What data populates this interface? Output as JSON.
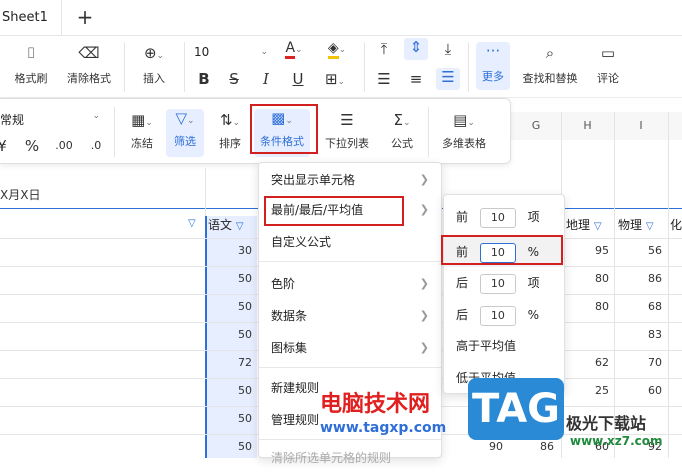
{
  "tabbar": {
    "sheet_name": "Sheet1",
    "add_label": "+"
  },
  "ribbon": {
    "format_painter": "格式刷",
    "clear_format": "清除格式",
    "insert": "插入",
    "font_size": "10",
    "more": "更多",
    "find_replace": "查找和替换",
    "comment": "评论"
  },
  "toolbar2": {
    "number_format": "常规",
    "percent": "%",
    "freeze": "冻结",
    "filter": "筛选",
    "sort": "排序",
    "conditional_format": "条件格式",
    "dropdown_list": "下拉列表",
    "formula": "公式",
    "multi_table": "多维表格"
  },
  "sheet": {
    "date_cell": "X月X日",
    "col_letters": [
      "G",
      "H",
      "I"
    ],
    "headers": {
      "chinese": "语文",
      "geography": "地理",
      "physics": "物理",
      "chem_partial": "化"
    },
    "chinese_values": [
      "30",
      "50",
      "50",
      "50",
      "72",
      "50",
      "50",
      "50"
    ],
    "geography_values": [
      "95",
      "80",
      "80",
      "",
      "62",
      "25",
      "",
      "60"
    ],
    "physics_values": [
      "56",
      "86",
      "68",
      "83",
      "70",
      "60",
      "",
      "92"
    ],
    "bottom_values": [
      "90",
      "86"
    ]
  },
  "menu": {
    "items": [
      "突出显示单元格",
      "最前/最后/平均值",
      "自定义公式",
      "色阶",
      "数据条",
      "图标集",
      "新建规则",
      "管理规则",
      "清除所选单元格的规则"
    ]
  },
  "submenu": {
    "top_n": {
      "prefix": "前",
      "value": "10",
      "suffix": "项"
    },
    "top_pct": {
      "prefix": "前",
      "value": "10",
      "suffix": "%"
    },
    "bottom_n": {
      "prefix": "后",
      "value": "10",
      "suffix": "项"
    },
    "bottom_pct": {
      "prefix": "后",
      "value": "10",
      "suffix": "%"
    },
    "above_avg": "高于平均值",
    "below_avg": "低于平均值"
  },
  "watermark": {
    "site_cn": "电脑技术网",
    "site_url": "www.tagxp.com",
    "logo": "TAG",
    "right_cn": "极光下载站",
    "right_url": "www.xz7.com"
  },
  "colors": {
    "accent": "#2e6fd8",
    "highlight_red": "#d21f1f",
    "selection_bg": "#e6eeff"
  }
}
